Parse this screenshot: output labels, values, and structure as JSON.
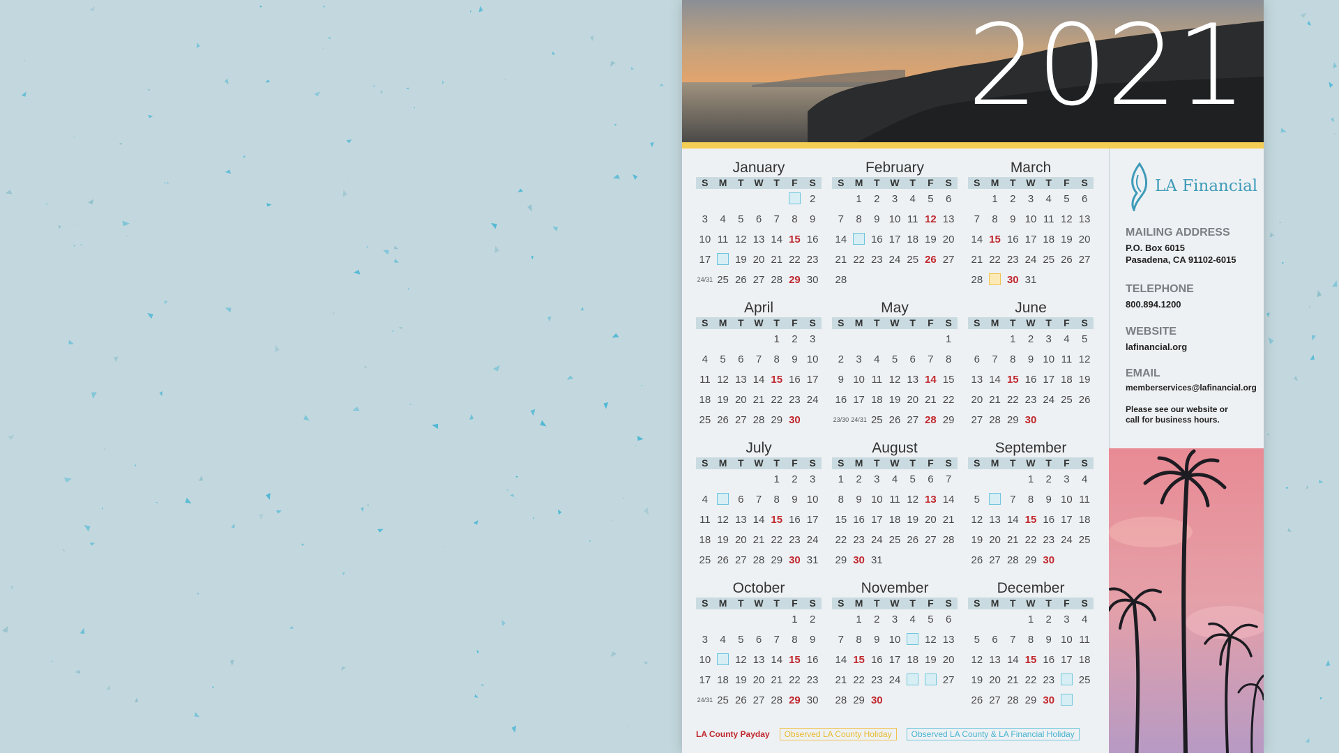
{
  "year": "2021",
  "colors": {
    "payday": "#c0272d",
    "observed_holiday": "#f1c24e",
    "la_financial_holiday": "#6ec6dc",
    "background": "#c3d8de",
    "accent_stripe": "#f4cd54"
  },
  "weekday_headers": [
    "S",
    "M",
    "T",
    "W",
    "T",
    "F",
    "S"
  ],
  "months": [
    {
      "name": "January",
      "cells": [
        "",
        "",
        "",
        "",
        "",
        "h",
        "2",
        "3",
        "4",
        "5",
        "6",
        "7",
        "8",
        "9",
        "10",
        "11",
        "12",
        "13",
        "14",
        "p15",
        "16",
        "17",
        "h",
        "19",
        "20",
        "21",
        "22",
        "23",
        "24/31",
        "25",
        "26",
        "27",
        "28",
        "p29",
        "30"
      ]
    },
    {
      "name": "February",
      "cells": [
        "",
        "1",
        "2",
        "3",
        "4",
        "5",
        "6",
        "7",
        "8",
        "9",
        "10",
        "11",
        "p12",
        "13",
        "14",
        "h",
        "16",
        "17",
        "18",
        "19",
        "20",
        "21",
        "22",
        "23",
        "24",
        "25",
        "p26",
        "27",
        "28"
      ]
    },
    {
      "name": "March",
      "cells": [
        "",
        "1",
        "2",
        "3",
        "4",
        "5",
        "6",
        "7",
        "8",
        "9",
        "10",
        "11",
        "12",
        "13",
        "14",
        "p15",
        "16",
        "17",
        "18",
        "19",
        "20",
        "21",
        "22",
        "23",
        "24",
        "25",
        "26",
        "27",
        "28",
        "o",
        "p30",
        "31"
      ]
    },
    {
      "name": "April",
      "cells": [
        "",
        "",
        "",
        "",
        "1",
        "2",
        "3",
        "4",
        "5",
        "6",
        "7",
        "8",
        "9",
        "10",
        "11",
        "12",
        "13",
        "14",
        "p15",
        "16",
        "17",
        "18",
        "19",
        "20",
        "21",
        "22",
        "23",
        "24",
        "25",
        "26",
        "27",
        "28",
        "29",
        "p30"
      ]
    },
    {
      "name": "May",
      "cells": [
        "",
        "",
        "",
        "",
        "",
        "",
        "1",
        "2",
        "3",
        "4",
        "5",
        "6",
        "7",
        "8",
        "9",
        "10",
        "11",
        "12",
        "13",
        "p14",
        "15",
        "16",
        "17",
        "18",
        "19",
        "20",
        "21",
        "22",
        "23/30",
        "24/31",
        "25",
        "26",
        "27",
        "p28",
        "29"
      ]
    },
    {
      "name": "June",
      "cells": [
        "",
        "",
        "1",
        "2",
        "3",
        "4",
        "5",
        "6",
        "7",
        "8",
        "9",
        "10",
        "11",
        "12",
        "13",
        "14",
        "p15",
        "16",
        "17",
        "18",
        "19",
        "20",
        "21",
        "22",
        "23",
        "24",
        "25",
        "26",
        "27",
        "28",
        "29",
        "p30"
      ]
    },
    {
      "name": "July",
      "cells": [
        "",
        "",
        "",
        "",
        "1",
        "2",
        "3",
        "4",
        "h",
        "6",
        "7",
        "8",
        "9",
        "10",
        "11",
        "12",
        "13",
        "14",
        "p15",
        "16",
        "17",
        "18",
        "19",
        "20",
        "21",
        "22",
        "23",
        "24",
        "25",
        "26",
        "27",
        "28",
        "29",
        "p30",
        "31"
      ]
    },
    {
      "name": "August",
      "cells": [
        "1",
        "2",
        "3",
        "4",
        "5",
        "6",
        "7",
        "8",
        "9",
        "10",
        "11",
        "12",
        "p13",
        "14",
        "15",
        "16",
        "17",
        "18",
        "19",
        "20",
        "21",
        "22",
        "23",
        "24",
        "25",
        "26",
        "27",
        "28",
        "29",
        "p30",
        "31"
      ]
    },
    {
      "name": "September",
      "cells": [
        "",
        "",
        "",
        "1",
        "2",
        "3",
        "4",
        "5",
        "h",
        "7",
        "8",
        "9",
        "10",
        "11",
        "12",
        "13",
        "14",
        "p15",
        "16",
        "17",
        "18",
        "19",
        "20",
        "21",
        "22",
        "23",
        "24",
        "25",
        "26",
        "27",
        "28",
        "29",
        "p30"
      ]
    },
    {
      "name": "October",
      "cells": [
        "",
        "",
        "",
        "",
        "",
        "1",
        "2",
        "3",
        "4",
        "5",
        "6",
        "7",
        "8",
        "9",
        "10",
        "h",
        "12",
        "13",
        "14",
        "p15",
        "16",
        "17",
        "18",
        "19",
        "20",
        "21",
        "22",
        "23",
        "24/31",
        "25",
        "26",
        "27",
        "28",
        "p29",
        "30"
      ]
    },
    {
      "name": "November",
      "cells": [
        "",
        "1",
        "2",
        "3",
        "4",
        "5",
        "6",
        "7",
        "8",
        "9",
        "10",
        "h",
        "12",
        "13",
        "14",
        "p15",
        "16",
        "17",
        "18",
        "19",
        "20",
        "21",
        "22",
        "23",
        "24",
        "h",
        "h",
        "27",
        "28",
        "29",
        "p30"
      ]
    },
    {
      "name": "December",
      "cells": [
        "",
        "",
        "",
        "1",
        "2",
        "3",
        "4",
        "5",
        "6",
        "7",
        "8",
        "9",
        "10",
        "11",
        "12",
        "13",
        "14",
        "p15",
        "16",
        "17",
        "18",
        "19",
        "20",
        "21",
        "22",
        "23",
        "h",
        "25",
        "26",
        "27",
        "28",
        "29",
        "p30",
        "h"
      ]
    }
  ],
  "legend": {
    "payday": "LA County Payday",
    "observed": "Observed LA County Holiday",
    "both": "Observed LA County & LA Financial Holiday"
  },
  "info": {
    "brand": "LA Financial",
    "mailing_label": "MAILING ADDRESS",
    "mailing_line1": "P.O. Box 6015",
    "mailing_line2": "Pasadena, CA 91102-6015",
    "telephone_label": "TELEPHONE",
    "telephone": "800.894.1200",
    "website_label": "WEBSITE",
    "website": "lafinancial.org",
    "email_label": "EMAIL",
    "email": "memberservices@lafinancial.org",
    "note": "Please see our website or call for business hours."
  }
}
